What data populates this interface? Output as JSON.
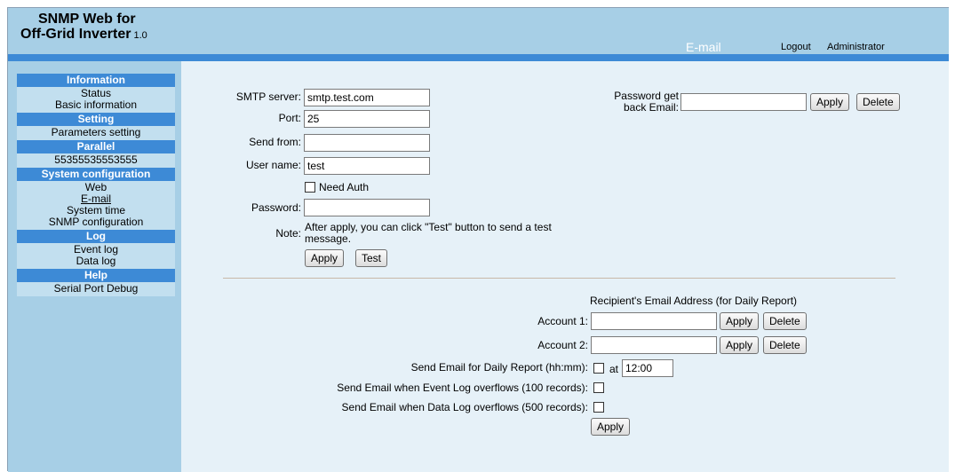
{
  "app": {
    "title_line1": "SNMP Web for",
    "title_line2": "Off-Grid Inverter",
    "version": "1.0"
  },
  "header": {
    "page_heading": "E-mail",
    "logout": "Logout",
    "user": "Administrator"
  },
  "sidebar": {
    "sections": [
      {
        "title": "Information",
        "items": [
          "Status",
          "Basic information"
        ]
      },
      {
        "title": "Setting",
        "items": [
          "Parameters setting"
        ]
      },
      {
        "title": "Parallel",
        "items": [
          "55355535553555"
        ]
      },
      {
        "title": "System configuration",
        "items": [
          "Web",
          "E-mail",
          "System time",
          "SNMP configuration"
        ]
      },
      {
        "title": "Log",
        "items": [
          "Event log",
          "Data log"
        ]
      },
      {
        "title": "Help",
        "items": [
          "Serial Port Debug"
        ]
      }
    ],
    "active_item": "E-mail"
  },
  "smtp": {
    "server_label": "SMTP server:",
    "server_value": "smtp.test.com",
    "port_label": "Port:",
    "port_value": "25",
    "from_label": "Send from:",
    "from_value": "",
    "user_label": "User name:",
    "user_value": "test",
    "need_auth_label": "Need Auth",
    "need_auth_checked": false,
    "password_label": "Password:",
    "password_value": "",
    "note_label": "Note:",
    "note_line1": "After apply, you can click \"Test\" button to send a test",
    "note_line2": "message.",
    "apply_label": "Apply",
    "test_label": "Test"
  },
  "password_back": {
    "label_line1": "Password get",
    "label_line2": "back Email:",
    "value": "",
    "apply_label": "Apply",
    "delete_label": "Delete"
  },
  "recipients": {
    "heading": "Recipient's Email Address (for Daily Report)",
    "accounts": [
      {
        "label": "Account 1:",
        "value": "",
        "apply": "Apply",
        "delete": "Delete"
      },
      {
        "label": "Account 2:",
        "value": "",
        "apply": "Apply",
        "delete": "Delete"
      }
    ],
    "daily_label": "Send Email for Daily Report (hh:mm):",
    "daily_checked": false,
    "at_label": "at",
    "time_value": "12:00",
    "event_overflow_label": "Send Email when Event Log overflows (100 records):",
    "event_checked": false,
    "data_overflow_label": "Send Email when Data Log overflows (500 records):",
    "data_checked": false,
    "apply_label": "Apply"
  }
}
